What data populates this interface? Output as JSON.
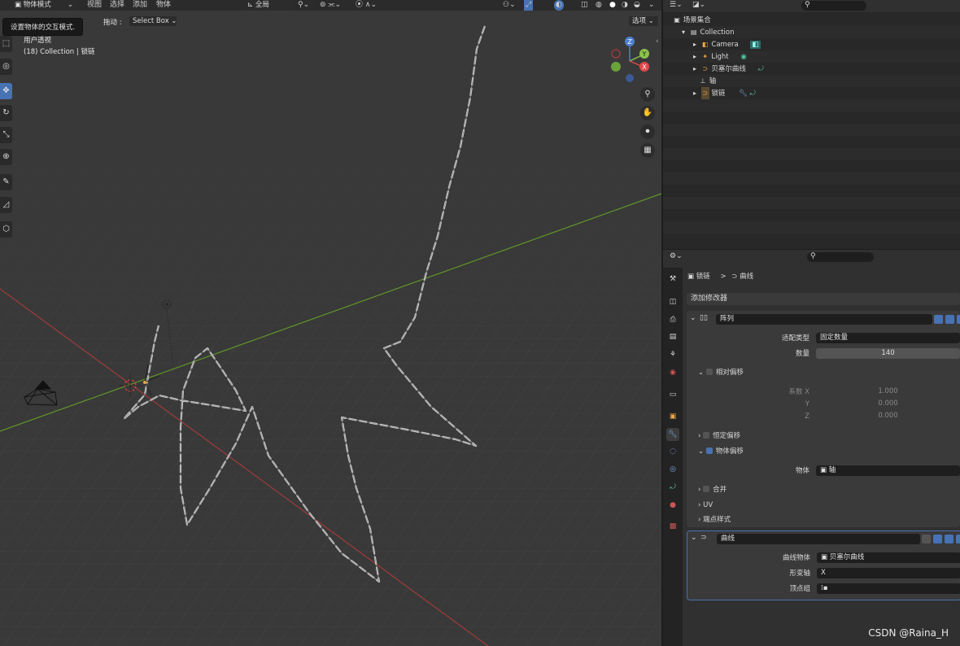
{
  "viewport": {
    "header": {
      "mode": "物体模式",
      "menus": [
        "视图",
        "选择",
        "添加",
        "物体"
      ],
      "orientation": "全局",
      "options": "选项"
    },
    "tooltip": "设置物体的交互模式.",
    "drag_label": "拖动 :",
    "drag_value": "Select Box",
    "view_name": "用户透视",
    "collection_info": "(18) Collection | 锁链",
    "gizmo": {
      "z": "Z",
      "y": "Y",
      "x": "X"
    }
  },
  "outliner": {
    "rows": [
      {
        "label": "场景集合"
      },
      {
        "label": "Collection"
      },
      {
        "label": "Camera"
      },
      {
        "label": "Light"
      },
      {
        "label": "贝塞尔曲线"
      },
      {
        "label": "轴"
      },
      {
        "label": "锁链"
      }
    ]
  },
  "properties": {
    "breadcrumb": {
      "object": "锁链",
      "separator": ">",
      "modifier": "曲线"
    },
    "add_modifier": "添加修改器",
    "array": {
      "name": "阵列",
      "fit_type_label": "适配类型",
      "fit_type_value": "固定数量",
      "count_label": "数量",
      "count_value": "140",
      "relative_offset": "相对偏移",
      "factor_x_label": "系数 X",
      "factor_x": "1.000",
      "y_label": "Y",
      "factor_y": "0.000",
      "z_label": "Z",
      "factor_z": "0.000",
      "constant_offset": "恒定偏移",
      "object_offset": "物体偏移",
      "object_label": "物体",
      "object_value": "轴",
      "merge": "合并",
      "uv": "UV",
      "caps": "端点样式"
    },
    "curve": {
      "name": "曲线",
      "curve_object_label": "曲线物体",
      "curve_object_value": "贝塞尔曲线",
      "deform_axis_label": "形变轴",
      "deform_axis_value": "X",
      "vertex_group_label": "顶点组"
    }
  },
  "watermark": "CSDN @Raina_H",
  "colors": {
    "accent": "#4772b3",
    "x_axis": "#9b3a3a",
    "y_axis": "#5f8f2a",
    "chain": "#cfcfcf"
  }
}
